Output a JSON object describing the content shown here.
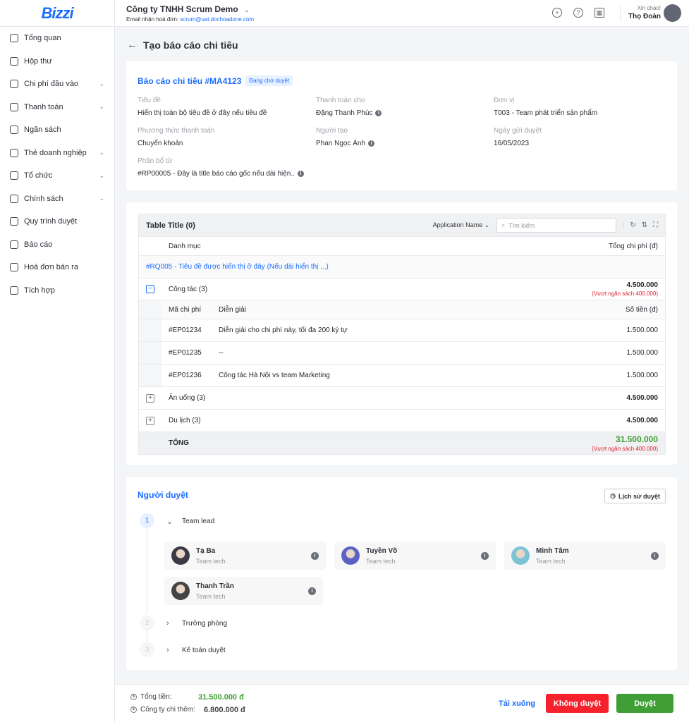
{
  "brand": {
    "logo": "Bizzi",
    "accent": "#1a6dff"
  },
  "sidebar": {
    "items": [
      {
        "label": "Tổng quan",
        "icon": "dashboard-icon",
        "chev": false
      },
      {
        "label": "Hộp thư",
        "icon": "inbox-icon",
        "chev": false
      },
      {
        "label": "Chi phí đầu vào",
        "icon": "download-icon",
        "chev": true
      },
      {
        "label": "Thanh toán",
        "icon": "payment-icon",
        "chev": true
      },
      {
        "label": "Ngân sách",
        "icon": "dollar-icon",
        "chev": false
      },
      {
        "label": "Thẻ doanh nghiệp",
        "icon": "card-icon",
        "chev": true
      },
      {
        "label": "Tổ chức",
        "icon": "org-icon",
        "chev": true
      },
      {
        "label": "Chính sách",
        "icon": "policy-icon",
        "chev": true
      },
      {
        "label": "Quy trình duyệt",
        "icon": "workflow-icon",
        "chev": false
      },
      {
        "label": "Báo cáo",
        "icon": "report-icon",
        "chev": false
      },
      {
        "label": "Hoá đơn bán ra",
        "icon": "upload-icon",
        "chev": false
      },
      {
        "label": "Tích hợp",
        "icon": "gear-icon",
        "chev": false
      }
    ]
  },
  "header": {
    "company": "Công ty TNHH Scrum Demo",
    "email_label": "Email nhận hoá đơn:",
    "email": "scrum@uat.dochoadone.com",
    "greeting": "Xin chào!",
    "user": "Thọ Đoàn"
  },
  "page": {
    "title": "Tạo báo cáo chi tiêu"
  },
  "report": {
    "title": "Báo cáo chi tiêu #MA4123",
    "status": "Đang chờ duyệt",
    "fields": [
      {
        "k": "Tiêu đề",
        "v": "Hiển thị toàn bộ tiêu đề ở đây nếu tiêu đề",
        "info": false
      },
      {
        "k": "Thanh toán cho",
        "v": "Đặng Thanh Phúc",
        "info": true
      },
      {
        "k": "Đơn vị",
        "v": "T003 - Team phát triển sản phẩm",
        "info": false
      },
      {
        "k": "Phương thức thanh toán",
        "v": "Chuyển khoản",
        "info": false
      },
      {
        "k": "Người tạo",
        "v": "Phan Ngọc Ánh",
        "info": true
      },
      {
        "k": "Ngày gửi duyệt",
        "v": "16/05/2023",
        "info": false
      },
      {
        "k": "Phân bổ từ",
        "v": "#RP00005 - Đây là title báo cáo gốc nếu dài hiện..",
        "info": true
      }
    ]
  },
  "table": {
    "title": "Table Title (0)",
    "filter": "Application Name",
    "search_placeholder": "Tìm kiếm",
    "col_category": "Danh mục",
    "col_total": "Tổng chi phí (đ)",
    "link": "#RQ005 - Tiêu đề được hiển thị ở đây (Nếu dài hiển thị ...)",
    "groups": [
      {
        "name": "Công tác (3)",
        "amount": "4.500.000",
        "over": "(Vượt ngân sách 400.000)",
        "expanded": true
      },
      {
        "name": "Ăn uống (3)",
        "amount": "4.500.000",
        "expanded": false
      },
      {
        "name": "Du lịch (3)",
        "amount": "4.500.000",
        "expanded": false
      }
    ],
    "sub_cols": [
      "Mã chi phí",
      "Diễn giải",
      "Số tiền (đ)"
    ],
    "sub_rows": [
      [
        "#EP01234",
        "Diễn giải cho chi phí này, tối đa 200 ký tự",
        "1.500.000"
      ],
      [
        "#EP01235",
        "--",
        "1.500.000"
      ],
      [
        "#EP01236",
        "Công tác Hà Nội vs team Marketing",
        "1.500.000"
      ]
    ],
    "total_label": "TỔNG",
    "total": "31.500.000",
    "total_over": "(Vượt ngân sách 400.000)"
  },
  "approvers": {
    "title": "Người duyệt",
    "history": "Lịch sử duyệt",
    "steps": [
      {
        "n": "1",
        "label": "Team lead"
      },
      {
        "n": "2",
        "label": "Trưởng phòng"
      },
      {
        "n": "3",
        "label": "Kế toán duyệt"
      }
    ],
    "people": [
      {
        "name": "Tạ Ba",
        "team": "Team tech"
      },
      {
        "name": "Tuyền Võ",
        "team": "Team tech"
      },
      {
        "name": "Minh Tâm",
        "team": "Team tech"
      },
      {
        "name": "Thanh Trần",
        "team": "Team tech"
      }
    ]
  },
  "footer": {
    "total_label": "Tổng tiền:",
    "total": "31.500.000 đ",
    "company_label": "Công ty chi thêm:",
    "company": "6.800.000 đ",
    "download": "Tải xuống",
    "reject": "Không duyệt",
    "approve": "Duyệt",
    "green": "#3f9f36",
    "red": "#f5222d"
  }
}
